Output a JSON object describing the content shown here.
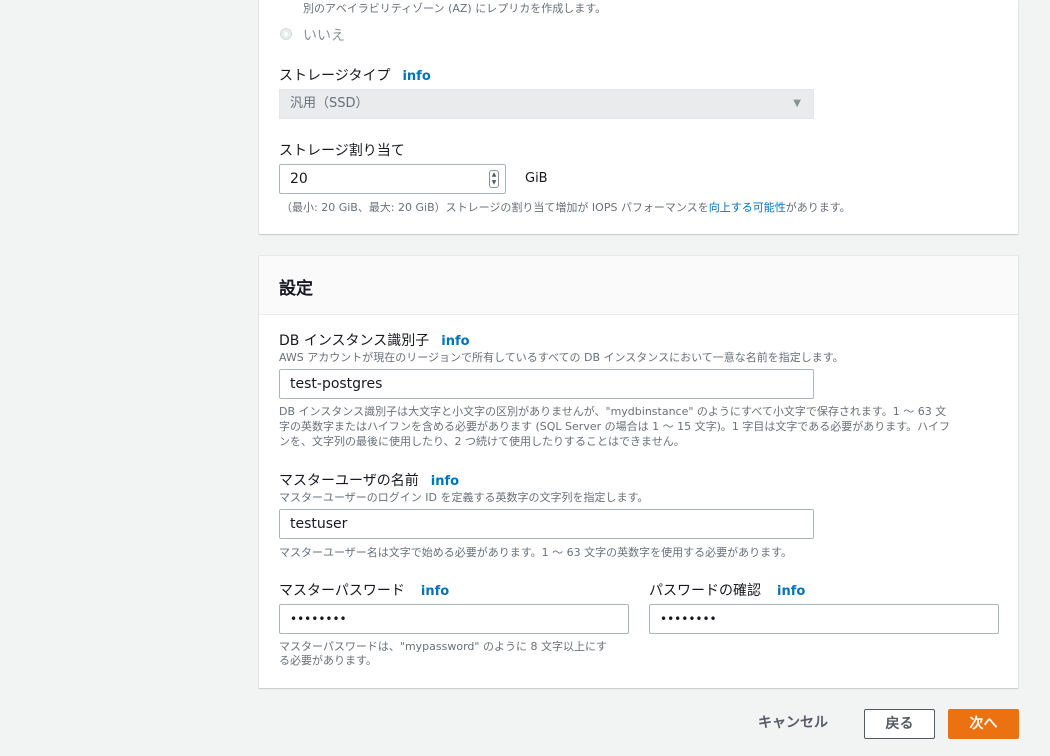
{
  "az_section": {
    "description": "別のアベイラビリティゾーン (AZ) にレプリカを作成します。",
    "radio_no_label": "いいえ"
  },
  "storage": {
    "type_label": "ストレージタイプ",
    "type_info": "info",
    "type_value": "汎用（SSD）",
    "alloc_label": "ストレージ割り当て",
    "alloc_value": "20",
    "alloc_unit": "GiB",
    "alloc_help_prefix": "（最小: 20 GiB、最大: 20 GiB）ストレージの割り当て増加が IOPS パフォーマンスを",
    "alloc_help_link": "向上する可能性",
    "alloc_help_suffix": "があります。"
  },
  "settings": {
    "title": "設定",
    "db_id_label": "DB インスタンス識別子",
    "db_id_info": "info",
    "db_id_desc": "AWS アカウントが現在のリージョンで所有しているすべての DB インスタンスにおいて一意な名前を指定します。",
    "db_id_value": "test-postgres",
    "db_id_help_1": "DB インスタンス識別子は大文字と小文字の区別がありませんが、\"mydbinstance\" のようにすべて小文字で保存されます。1 〜 63 文",
    "db_id_help_2": "字の英数字またはハイフンを含める必要があります (SQL Server の場合は 1 〜 15 文字)。1 字目は文字である必要があります。ハイフ",
    "db_id_help_3": "ンを、文字列の最後に使用したり、2 つ続けて使用したりすることはできません。",
    "master_user_label": "マスターユーザの名前",
    "master_user_info": "info",
    "master_user_desc": "マスターユーザーのログイン ID を定義する英数字の文字列を指定します。",
    "master_user_value": "testuser",
    "master_user_help": "マスターユーザー名は文字で始める必要があります。1 〜 63 文字の英数字を使用する必要があります。",
    "master_pw_label": "マスターパスワード",
    "master_pw_info": "info",
    "master_pw_value": "••••••••",
    "master_pw_help_1": "マスターパスワードは、\"mypassword\" のように 8 文字以上にす",
    "master_pw_help_2": "る必要があります。",
    "confirm_pw_label": "パスワードの確認",
    "confirm_pw_info": "info",
    "confirm_pw_value": "••••••••"
  },
  "footer": {
    "cancel": "キャンセル",
    "back": "戻る",
    "next": "次へ"
  },
  "colors": {
    "primary": "#ec7211",
    "link": "#0073bb"
  }
}
